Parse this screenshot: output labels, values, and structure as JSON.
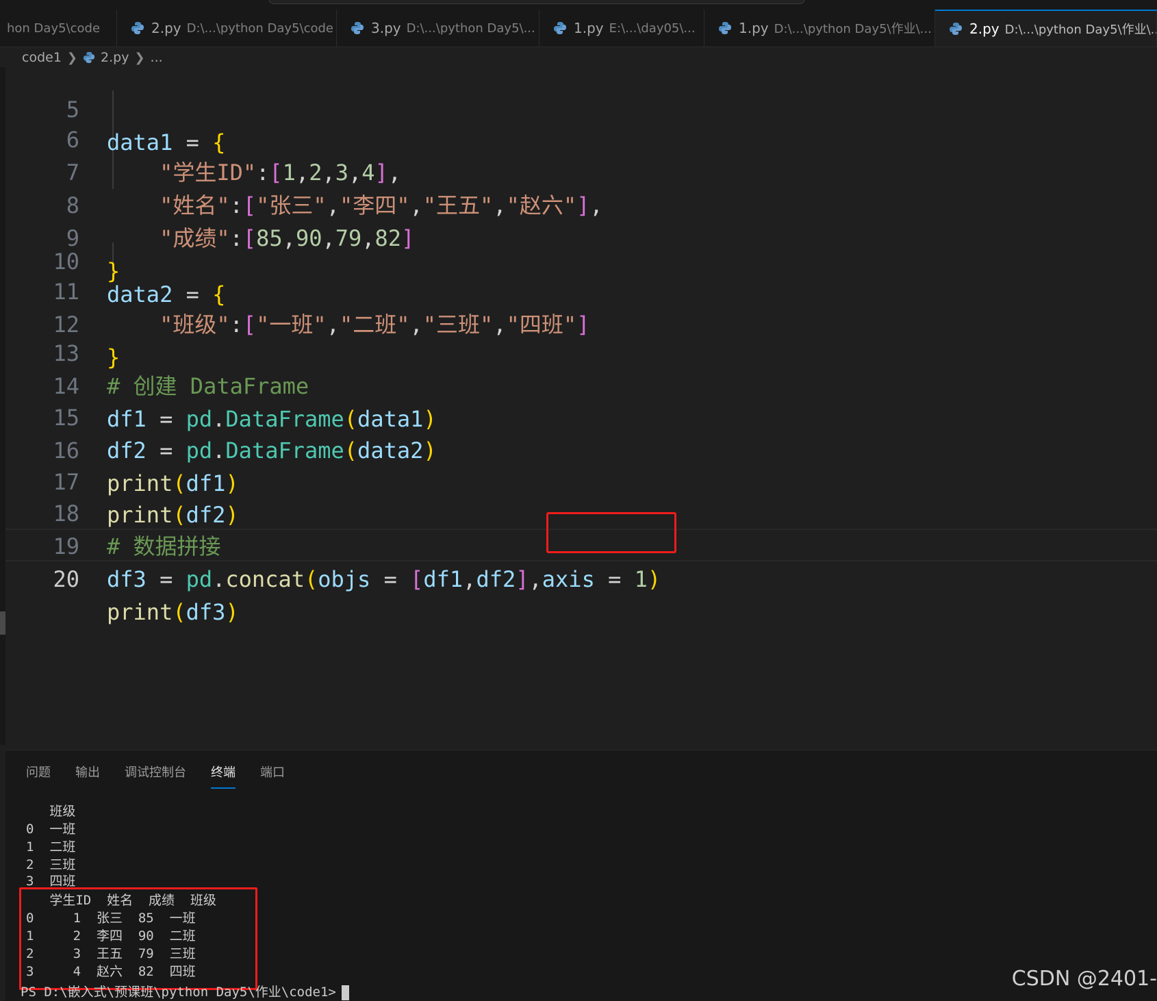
{
  "tabs": [
    {
      "name": "",
      "path": "hon Day5\\code",
      "active": false,
      "dirty": false
    },
    {
      "name": "2.py",
      "path": "D:\\...\\python Day5\\code",
      "active": false,
      "dirty": false
    },
    {
      "name": "3.py",
      "path": "D:\\...\\python Day5\\...",
      "active": false,
      "dirty": true
    },
    {
      "name": "1.py",
      "path": "E:\\...\\day05\\...",
      "active": false,
      "dirty": false
    },
    {
      "name": "1.py",
      "path": "D:\\...\\python Day5\\作业\\...",
      "active": false,
      "dirty": false
    },
    {
      "name": "2.py",
      "path": "D:\\...\\python Day5\\作业\\...",
      "active": true,
      "dirty": false
    }
  ],
  "tab_close": "✕",
  "breadcrumb": {
    "folder": "code1",
    "file": "2.py",
    "more": "..."
  },
  "editor": {
    "lines": [
      {
        "no": "5"
      },
      {
        "no": "6"
      },
      {
        "no": "7"
      },
      {
        "no": "8"
      },
      {
        "no": "9"
      },
      {
        "no": "10"
      },
      {
        "no": "11"
      },
      {
        "no": "12"
      },
      {
        "no": "13"
      },
      {
        "no": "14"
      },
      {
        "no": "15"
      },
      {
        "no": "16"
      },
      {
        "no": "17"
      },
      {
        "no": "18"
      },
      {
        "no": "19"
      },
      {
        "no": "20"
      }
    ],
    "tok": {
      "data1": "data1",
      "data2": "data2",
      "eq": " = ",
      "lbrace": "{",
      "rbrace": "}",
      "k_id": "\"学生ID\"",
      "k_name": "\"姓名\"",
      "k_score": "\"成绩\"",
      "k_class": "\"班级\"",
      "colon": ":",
      "lbr": "[",
      "rbr": "]",
      "comma": ",",
      "n1": "1",
      "n2": "2",
      "n3": "3",
      "n4": "4",
      "zs": "\"张三\"",
      "ls": "\"李四\"",
      "ww": "\"王五\"",
      "zl": "\"赵六\"",
      "s85": "85",
      "s90": "90",
      "s79": "79",
      "s82": "82",
      "c1": "\"一班\"",
      "c2": "\"二班\"",
      "c3": "\"三班\"",
      "c4": "\"四班\"",
      "cm13": "# 创建 DataFrame",
      "cm18": "# 数据拼接",
      "df1": "df1",
      "df2": "df2",
      "df3": "df3",
      "pd": "pd",
      "dot": ".",
      "DataFrame": "DataFrame",
      "lp": "(",
      "rp": ")",
      "print": "print",
      "concat": "concat",
      "objs": "objs",
      "axis": "axis",
      "one": "1"
    }
  },
  "panel": {
    "tabs": [
      "问题",
      "输出",
      "调试控制台",
      "终端",
      "端口"
    ],
    "active_tab": "终端",
    "terminal_lines": [
      "   班级",
      "0  一班",
      "1  二班",
      "2  三班",
      "3  四班",
      "   学生ID  姓名  成绩  班级",
      "0     1  张三  85  一班",
      "1     2  李四  90  二班",
      "2     3  王五  79  三班",
      "3     4  赵六  82  四班"
    ],
    "prompt": "PS D:\\嵌入式\\预课班\\python Day5\\作业\\code1>"
  },
  "watermark": "CSDN @2401-",
  "colors": {
    "accent": "#0078d4",
    "highlight_box": "#f01c1c"
  },
  "icons": {
    "python": "python-file-icon",
    "chevron": "chevron-right-icon",
    "close": "close-icon"
  }
}
